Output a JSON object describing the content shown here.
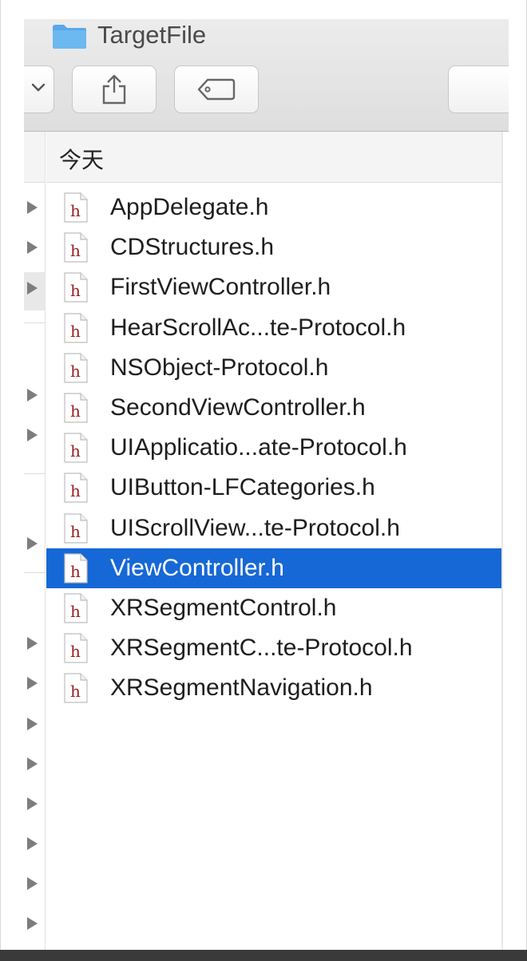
{
  "window": {
    "title": "TargetFile",
    "column_header": "今天"
  },
  "toolbar": {
    "view_icon": "chevron-down-icon",
    "share_icon": "share-icon",
    "tag_icon": "tag-icon"
  },
  "files": [
    {
      "name": "AppDelegate.h"
    },
    {
      "name": "CDStructures.h"
    },
    {
      "name": "FirstViewController.h"
    },
    {
      "name": "HearScrollAc...te-Protocol.h"
    },
    {
      "name": "NSObject-Protocol.h"
    },
    {
      "name": "SecondViewController.h"
    },
    {
      "name": "UIApplicatio...ate-Protocol.h"
    },
    {
      "name": "UIButton-LFCategories.h"
    },
    {
      "name": "UIScrollView...te-Protocol.h"
    },
    {
      "name": "ViewController.h",
      "selected": true
    },
    {
      "name": "XRSegmentControl.h"
    },
    {
      "name": "XRSegmentC...te-Protocol.h"
    },
    {
      "name": "XRSegmentNavigation.h"
    }
  ],
  "file_icon_letter": "h",
  "colors": {
    "selection": "#1668d6",
    "folder": "#5aa8e8",
    "header_icon_letter": "#9b1c1c"
  }
}
